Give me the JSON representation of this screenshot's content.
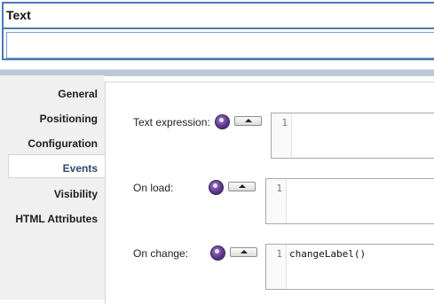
{
  "component": {
    "title": "Text"
  },
  "nav": {
    "items": [
      {
        "label": "General"
      },
      {
        "label": "Positioning"
      },
      {
        "label": "Configuration"
      },
      {
        "label": "Events",
        "active": true
      },
      {
        "label": "Visibility"
      },
      {
        "label": "HTML Attributes"
      }
    ]
  },
  "events": {
    "text_expression": {
      "label": "Text expression:",
      "line": "1",
      "code": ""
    },
    "on_load": {
      "label": "On load:",
      "line": "1",
      "code": ""
    },
    "on_change": {
      "label": "On change:",
      "line": "1",
      "code": "changeLabel()"
    }
  },
  "colors": {
    "accent": "#4a7ab5",
    "active_nav_text": "#2c4a6e",
    "script_button": "#5d3a8c"
  },
  "icons": {
    "script_button": "script-expression-icon",
    "collapse_button": "triangle-up-icon"
  }
}
